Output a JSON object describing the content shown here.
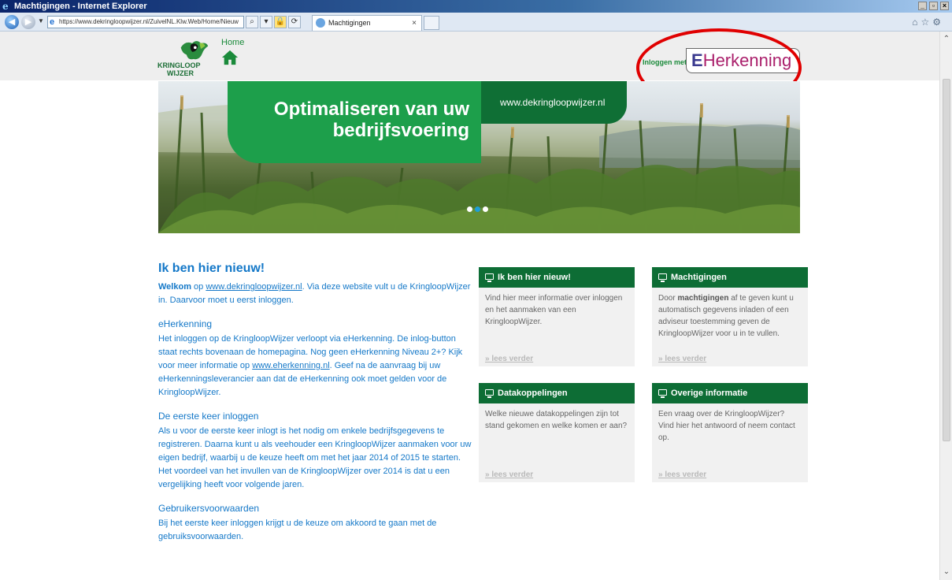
{
  "window": {
    "title": "Machtigingen - Internet Explorer"
  },
  "browser": {
    "address": "https://www.dekringloopwijzer.nl/ZuivelNL.Klw.Web/Home/Nieuw",
    "tab_title": "Machtigingen",
    "tab_close": "×"
  },
  "site": {
    "logo_line1": "KRINGLOOP",
    "logo_line2": "WIJZER",
    "home_label": "Home",
    "login_label": "Inloggen met",
    "eh_prefix": "E",
    "eh_rest": "Herkenning"
  },
  "hero": {
    "headline_1": "Optimaliseren van uw",
    "headline_2": "bedrijfsvoering",
    "url": "www.dekringloopwijzer.nl",
    "slide_count": 3,
    "active_slide": 2
  },
  "article": {
    "title": "Ik ben hier nieuw!",
    "intro_bold": "Welkom",
    "intro_op": " op ",
    "intro_link": "www.dekringloopwijzer.nl",
    "intro_rest": ". Via deze website vult u de KringloopWijzer in. Daarvoor moet u eerst inloggen.",
    "s1_title": "eHerkenning",
    "s1_text_a": "Het inloggen op de KringloopWijzer verloopt via eHerkenning. De inlog-button staat rechts bovenaan de homepagina. Nog geen eHerkenning Niveau 2+? Kijk voor meer informatie op ",
    "s1_link": "www.eherkenning.nl",
    "s1_text_b": ". Geef na de aanvraag bij uw eHerkenningsleverancier aan dat de eHerkenning ook moet gelden voor de KringloopWijzer.",
    "s2_title": "De eerste keer inloggen",
    "s2_text": "Als u voor de eerste keer inlogt is het nodig om enkele bedrijfsgegevens te registreren. Daarna kunt u als veehouder een KringloopWijzer aanmaken voor uw eigen bedrijf, waarbij u de keuze heeft om met het jaar 2014 of 2015 te starten. Het voordeel van het invullen van de KringloopWijzer over 2014 is dat u een vergelijking heeft voor volgende jaren.",
    "s3_title": "Gebruikersvoorwaarden",
    "s3_text": "Bij het eerste keer inloggen krijgt u de keuze om akkoord te gaan met de gebruiksvoorwaarden."
  },
  "cards": {
    "nieuw": {
      "title": "Ik ben hier nieuw!",
      "body": "Vind hier meer informatie over inloggen en het aanmaken van een KringloopWijzer.",
      "more": "» lees verder"
    },
    "machtigingen": {
      "title": "Machtigingen",
      "body_a": "Door ",
      "body_bold": "machtigingen",
      "body_b": " af te geven kunt u automatisch gegevens inladen of een adviseur toestemming geven de KringloopWijzer voor u in te vullen.",
      "more": "» lees verder"
    },
    "data": {
      "title": "Datakoppelingen",
      "body": "Welke nieuwe datakoppelingen zijn tot stand gekomen en welke komen er aan?",
      "more": "» lees verder"
    },
    "overig": {
      "title": "Overige informatie",
      "body": "Een vraag over de KringloopWijzer? Vind hier het antwoord of neem contact op.",
      "more": "» lees verder"
    }
  },
  "colors": {
    "brand_green": "#0d6d35",
    "link_blue": "#1478c8",
    "highlight_red": "#e00000"
  }
}
